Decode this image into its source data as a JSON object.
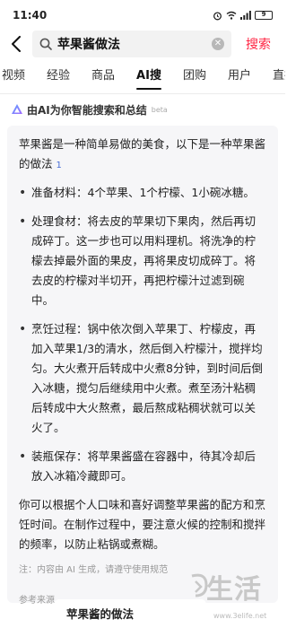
{
  "status": {
    "time": "11:40",
    "battery": "9"
  },
  "search": {
    "query": "苹果酱做法",
    "submit_label": "搜索"
  },
  "tabs": [
    {
      "label": "视频"
    },
    {
      "label": "经验"
    },
    {
      "label": "商品"
    },
    {
      "label": "AI搜",
      "active": true
    },
    {
      "label": "团购"
    },
    {
      "label": "用户"
    },
    {
      "label": "直播"
    }
  ],
  "ai_header": {
    "title": "由AI为你智能搜索和总结",
    "badge": "beta"
  },
  "answer": {
    "intro": "苹果酱是一种简单易做的美食，以下是一种苹果酱的做法",
    "cite": "1",
    "steps": [
      "准备材料：4个苹果、1个柠檬、1小碗冰糖。",
      "处理食材：将去皮的苹果切下果肉，然后再切成碎丁。这一步也可以用料理机。将洗净的柠檬去掉最外面的果皮，再将果皮切成碎丁。将去皮的柠檬对半切开，再把柠檬汁过滤到碗中。",
      "烹饪过程：锅中依次倒入苹果丁、柠檬皮，再加入苹果1/3的清水，然后倒入柠檬汁，搅拌均匀。大火煮开后转成中火煮8分钟，到时间后倒入冰糖，搅匀后继续用中火煮。煮至汤汁粘稠后转成中大火熬煮，最后熬成粘稠状就可以关火了。",
      "装瓶保存：将苹果酱盛在容器中，待其冷却后放入冰箱冷藏即可。"
    ],
    "outro": "你可以根据个人口味和喜好调整苹果酱的配方和烹饪时间。在制作过程中，要注意火候的控制和搅拌的频率，以防止粘锅或煮糊。",
    "note": "注：内容由 AI 生成，请遵守使用规范"
  },
  "references": {
    "label": "参考来源",
    "first_title": "苹果酱的做法"
  },
  "watermark": {
    "text": "生活",
    "url": "www.3elife.net"
  },
  "colors": {
    "accent": "#ff2442",
    "link": "#4a6fd6"
  },
  "icons": [
    "back-icon",
    "search-icon",
    "clear-icon",
    "ai-logo-icon",
    "alarm-icon",
    "wifi-icon",
    "signal-icon",
    "battery-icon"
  ]
}
